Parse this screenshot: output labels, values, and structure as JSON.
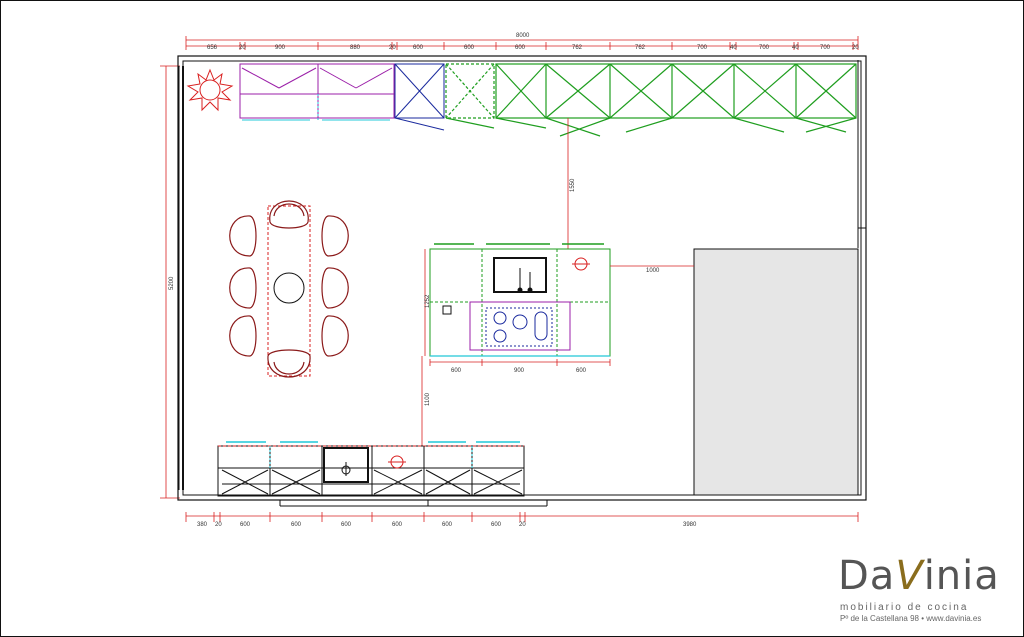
{
  "drawing": {
    "top_dims": {
      "total": "8000",
      "segments": [
        "656",
        "20",
        "900",
        "880",
        "20",
        "600",
        "600",
        "600",
        "762",
        "762",
        "700",
        "40",
        "700",
        "40",
        "700",
        "20"
      ]
    },
    "bottom_dims": {
      "segments": [
        "380",
        "20",
        "600",
        "600",
        "600",
        "600",
        "600",
        "600",
        "20",
        "3980"
      ]
    },
    "left_dim": "5200",
    "upper_link_dim": "1550",
    "island_right_dim": "1000",
    "island_height_dim": "1252",
    "island_bottom_dims": [
      "600",
      "900",
      "600"
    ],
    "lower_link_dim": "1100"
  },
  "logo": {
    "brand_pre": "Da",
    "brand_v": "V",
    "brand_post": "inia",
    "tagline": "mobiliario de cocina",
    "address": "Pº de la Castellana 98 • www.davinia.es"
  },
  "colors": {
    "dimension_red": "#d92020",
    "tall_units_purple": "#9b1fa8",
    "upper_cabinet_green": "#1f9e1f",
    "dining_red": "#8b1a1a",
    "appliance_blue": "#1a2a9e",
    "cyan_accent": "#21c8d8",
    "pantry_grey": "#e6e6e6"
  }
}
